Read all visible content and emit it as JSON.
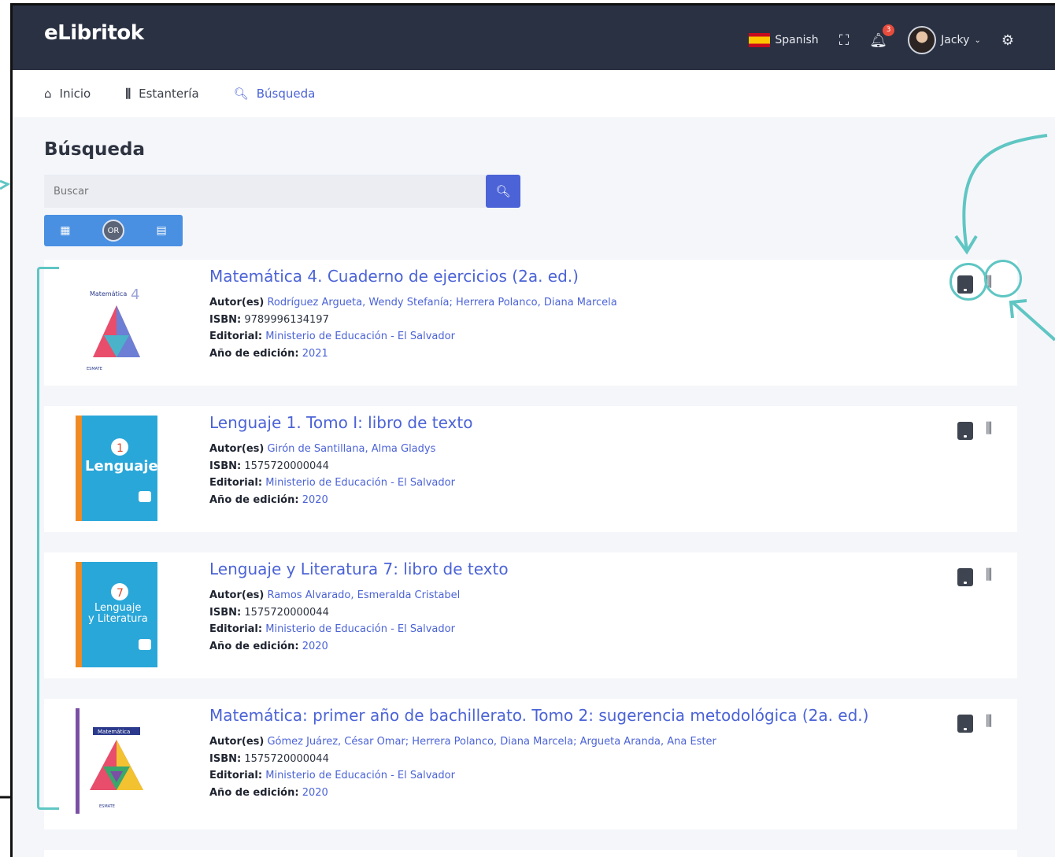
{
  "header": {
    "logo": "eLibritok",
    "language": "Spanish",
    "notifications_count": "3",
    "username": "Jacky",
    "user_chevron": "⌄"
  },
  "nav": {
    "items": [
      {
        "label": "Inicio",
        "icon": "home-icon"
      },
      {
        "label": "Estantería",
        "icon": "bookshelf-icon"
      },
      {
        "label": "Búsqueda",
        "icon": "search-icon",
        "active": true
      }
    ]
  },
  "page": {
    "title": "Búsqueda",
    "search_placeholder": "Buscar",
    "view_toggle": {
      "grid_icon": "grid-icon",
      "or_label": "OR",
      "list_icon": "list-icon"
    }
  },
  "labels": {
    "author": "Autor(es)",
    "isbn": "ISBN:",
    "publisher": "Editorial:",
    "year": "Año de edición:"
  },
  "books": [
    {
      "title": "Matemática 4. Cuaderno de ejercicios (2a. ed.)",
      "authors": "Rodríguez Argueta, Wendy Stefanía; Herrera Polanco, Diana Marcela",
      "isbn": "9789996134197",
      "publisher": "Ministerio de Educación - El Salvador",
      "year": "2021",
      "cover_label": "Matemática 4",
      "cover_color": "#ffffff"
    },
    {
      "title": "Lenguaje 1. Tomo I: libro de texto",
      "authors": "Girón de Santillana, Alma Gladys",
      "isbn": "1575720000044",
      "publisher": "Ministerio de Educación - El Salvador",
      "year": "2020",
      "cover_label": "Lenguaje",
      "cover_color": "#2aa7d9"
    },
    {
      "title": "Lenguaje y Literatura 7: libro de texto",
      "authors": "Ramos Alvarado, Esmeralda Cristabel",
      "isbn": "1575720000044",
      "publisher": "Ministerio de Educación - El Salvador",
      "year": "2020",
      "cover_label": "Lenguaje y Literatura",
      "cover_color": "#2aa7d9"
    },
    {
      "title": "Matemática: primer año de bachillerato. Tomo 2: sugerencia metodológica (2a. ed.)",
      "authors": "Gómez Juárez, César Omar; Herrera Polanco, Diana Marcela; Argueta Aranda, Ana Ester",
      "isbn": "1575720000044",
      "publisher": "Ministerio de Educación - El Salvador",
      "year": "2020",
      "cover_label": "Matemática",
      "cover_color": "#ffffff"
    }
  ],
  "colors": {
    "accent": "#4b63d6",
    "topbar": "#2a3142",
    "annotation": "#5fc6c3"
  }
}
